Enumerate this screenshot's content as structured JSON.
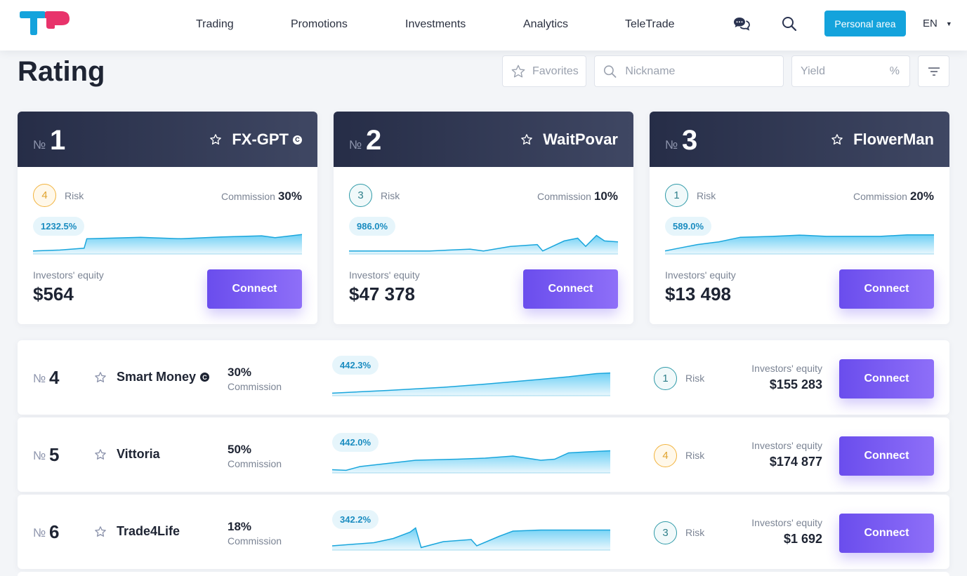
{
  "header": {
    "nav": [
      "Trading",
      "Promotions",
      "Investments",
      "Analytics",
      "TeleTrade"
    ],
    "personal_area": "Personal area",
    "language": "EN",
    "colors": {
      "accent": "#14a3dc",
      "logo_blue": "#14a3dc",
      "logo_pink": "#e8336b"
    }
  },
  "page": {
    "title": "Rating",
    "filters": {
      "favorites": "Favorites",
      "nickname_placeholder": "Nickname",
      "yield_placeholder": "Yield",
      "yield_unit": "%"
    }
  },
  "top_traders": [
    {
      "rank_symbol": "№",
      "rank": "1",
      "name": "FX-GPT",
      "verified": true,
      "verified_symbol": "C",
      "risk": "4",
      "risk_label": "Risk",
      "risk_color": "#f2b33d",
      "commission_label": "Commission",
      "commission": "30%",
      "yield": "1232.5%",
      "equity_label": "Investors' equity",
      "equity": "$564",
      "connect": "Connect"
    },
    {
      "rank_symbol": "№",
      "rank": "2",
      "name": "WaitPovar",
      "verified": false,
      "risk": "3",
      "risk_label": "Risk",
      "risk_color": "#2e9aa8",
      "commission_label": "Commission",
      "commission": "10%",
      "yield": "986.0%",
      "equity_label": "Investors' equity",
      "equity": "$47 378",
      "connect": "Connect"
    },
    {
      "rank_symbol": "№",
      "rank": "3",
      "name": "FlowerMan",
      "verified": false,
      "risk": "1",
      "risk_label": "Risk",
      "risk_color": "#2e9aa8",
      "commission_label": "Commission",
      "commission": "20%",
      "yield": "589.0%",
      "equity_label": "Investors' equity",
      "equity": "$13 498",
      "connect": "Connect"
    }
  ],
  "traders": [
    {
      "rank_symbol": "№",
      "rank": "4",
      "name": "Smart Money",
      "verified": true,
      "verified_symbol": "C",
      "commission": "30%",
      "commission_label": "Commission",
      "yield": "442.3%",
      "risk": "1",
      "risk_label": "Risk",
      "risk_color": "#2e9aa8",
      "equity_label": "Investors' equity",
      "equity": "$155 283",
      "connect": "Connect"
    },
    {
      "rank_symbol": "№",
      "rank": "5",
      "name": "Vittoria",
      "verified": false,
      "commission": "50%",
      "commission_label": "Commission",
      "yield": "442.0%",
      "risk": "4",
      "risk_label": "Risk",
      "risk_color": "#f2b33d",
      "equity_label": "Investors' equity",
      "equity": "$174 877",
      "connect": "Connect"
    },
    {
      "rank_symbol": "№",
      "rank": "6",
      "name": "Trade4Life",
      "verified": false,
      "commission": "18%",
      "commission_label": "Commission",
      "yield": "342.2%",
      "risk": "3",
      "risk_label": "Risk",
      "risk_color": "#2e9aa8",
      "equity_label": "Investors' equity",
      "equity": "$1 692",
      "connect": "Connect"
    }
  ]
}
